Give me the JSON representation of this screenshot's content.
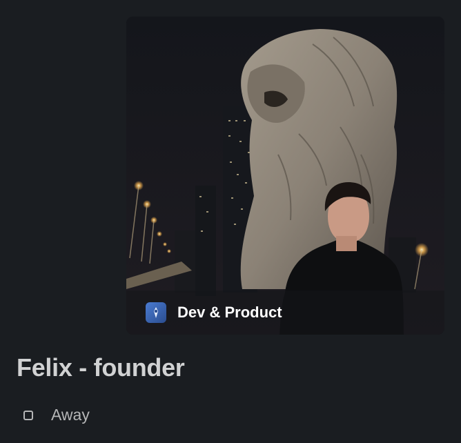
{
  "profile": {
    "team": {
      "name": "Dev & Product",
      "icon": "team-icon"
    },
    "display_name": "Felix - founder",
    "presence": {
      "label": "Away",
      "icon": "away-status-icon"
    }
  },
  "colors": {
    "background": "#1a1d21",
    "name_text": "#d1d2d3",
    "status_text": "#b5b6b7",
    "team_icon": "#4a7bd1"
  }
}
